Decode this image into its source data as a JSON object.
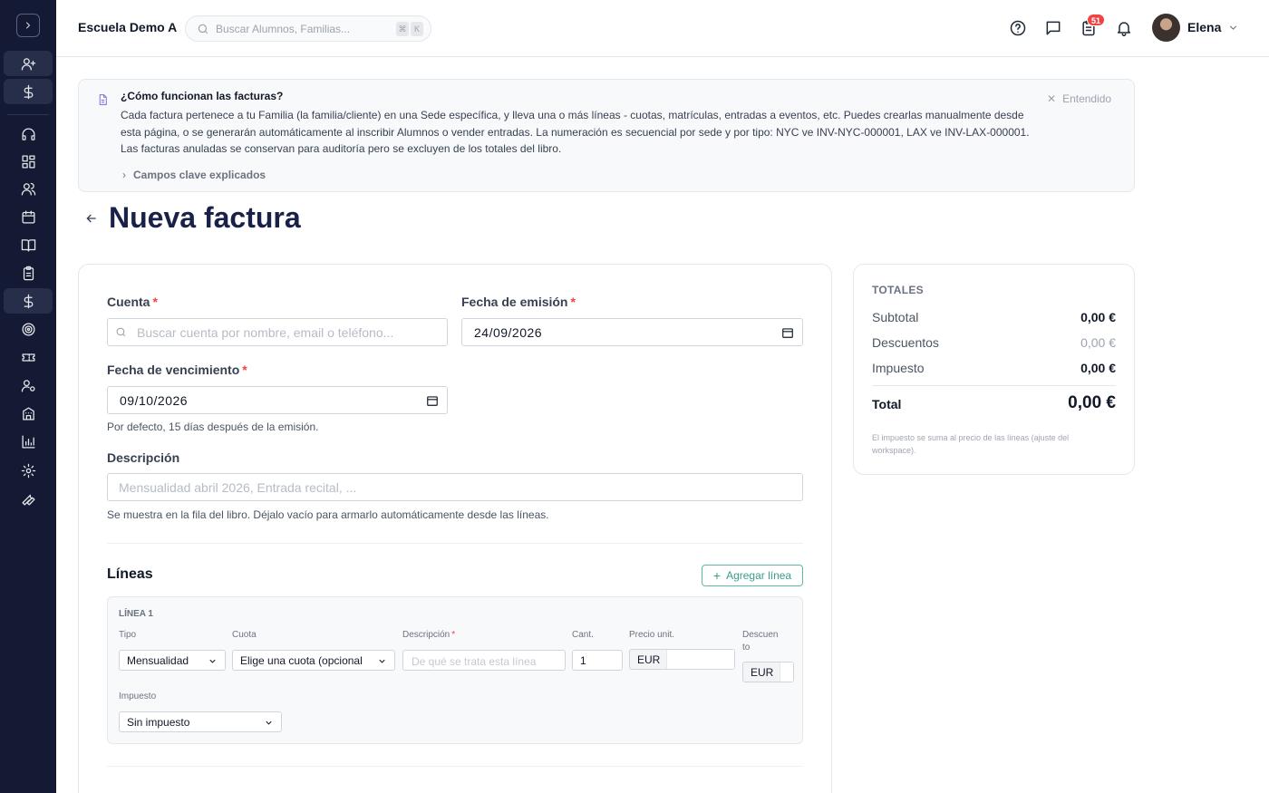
{
  "sidebar": {
    "toggle_icon": "chevron-right-icon",
    "items": [
      {
        "icon": "user-plus-icon"
      },
      {
        "icon": "dollar-icon"
      },
      {
        "icon": "headset-icon"
      },
      {
        "icon": "grid-icon"
      },
      {
        "icon": "users-icon"
      },
      {
        "icon": "calendar-icon"
      },
      {
        "icon": "book-icon"
      },
      {
        "icon": "clipboard-icon"
      },
      {
        "icon": "dollar-icon",
        "active": true
      },
      {
        "icon": "target-icon"
      },
      {
        "icon": "ticket-icon"
      },
      {
        "icon": "user-settings-icon"
      },
      {
        "icon": "building-icon"
      },
      {
        "icon": "bar-chart-icon"
      },
      {
        "icon": "gear-icon"
      },
      {
        "icon": "wrench-icon"
      }
    ]
  },
  "topbar": {
    "school_name": "Escuela Demo A",
    "search_placeholder": "Buscar Alumnos, Familias...",
    "kbd_mod": "⌘",
    "kbd_key": "K",
    "tasks_badge": "51",
    "user_name": "Elena"
  },
  "info": {
    "title": "¿Cómo funcionan las facturas?",
    "body": "Cada factura pertenece a tu Familia (la familia/cliente) en una Sede específica, y lleva una o más líneas - cuotas, matrículas, entradas a eventos, etc. Puedes crearlas manualmente desde esta página, o se generarán automáticamente al inscribir Alumnos o vender entradas. La numeración es secuencial por sede y por tipo: NYC ve INV-NYC-000001, LAX ve INV-LAX-000001. Las facturas anuladas se conservan para auditoría pero se excluyen de los totales del libro.",
    "fields_toggle": "Campos clave explicados",
    "dismiss": "Entendido"
  },
  "page": {
    "title": "Nueva factura"
  },
  "form": {
    "cuenta_label": "Cuenta",
    "cuenta_placeholder": "Buscar cuenta por nombre, email o teléfono...",
    "emision_label": "Fecha de emisión",
    "emision_value": "24/09/2026",
    "venc_label": "Fecha de vencimiento",
    "venc_value": "09/10/2026",
    "venc_hint": "Por defecto, 15 días después de la emisión.",
    "desc_label": "Descripción",
    "desc_placeholder": "Mensualidad abril 2026, Entrada recital, ...",
    "desc_hint": "Se muestra en la fila del libro. Déjalo vacío para armarlo automáticamente desde las líneas.",
    "required_mark": "*"
  },
  "lines": {
    "section_title": "Líneas",
    "add_label": "Agregar línea",
    "items": [
      {
        "title": "LÍNEA 1",
        "tipo_label": "Tipo",
        "tipo_value": "Mensualidad",
        "cuota_label": "Cuota",
        "cuota_value": "Elige una cuota (opcional",
        "desc_label": "Descripción",
        "desc_placeholder": "De qué se trata esta línea",
        "cant_label": "Cant.",
        "cant_value": "1",
        "precio_label": "Precio unit.",
        "precio_currency": "EUR",
        "descuento_label_1": "Descuen",
        "descuento_label_2": "to",
        "descuento_currency": "EUR",
        "impuesto_label": "Impuesto",
        "impuesto_value": "Sin impuesto"
      }
    ]
  },
  "totals": {
    "heading": "TOTALES",
    "subtotal_label": "Subtotal",
    "subtotal_value": "0,00 €",
    "descuentos_label": "Descuentos",
    "descuentos_value": "0,00 €",
    "impuesto_label": "Impuesto",
    "impuesto_value": "0,00 €",
    "total_label": "Total",
    "total_value": "0,00 €",
    "note": "El impuesto se suma al precio de las líneas (ajuste del workspace)."
  },
  "colors": {
    "sidebar_bg": "#141a33",
    "title": "#1a2148",
    "accent_teal": "#3a9d8d",
    "badge_red": "#ef4444",
    "required": "#ef4444"
  }
}
